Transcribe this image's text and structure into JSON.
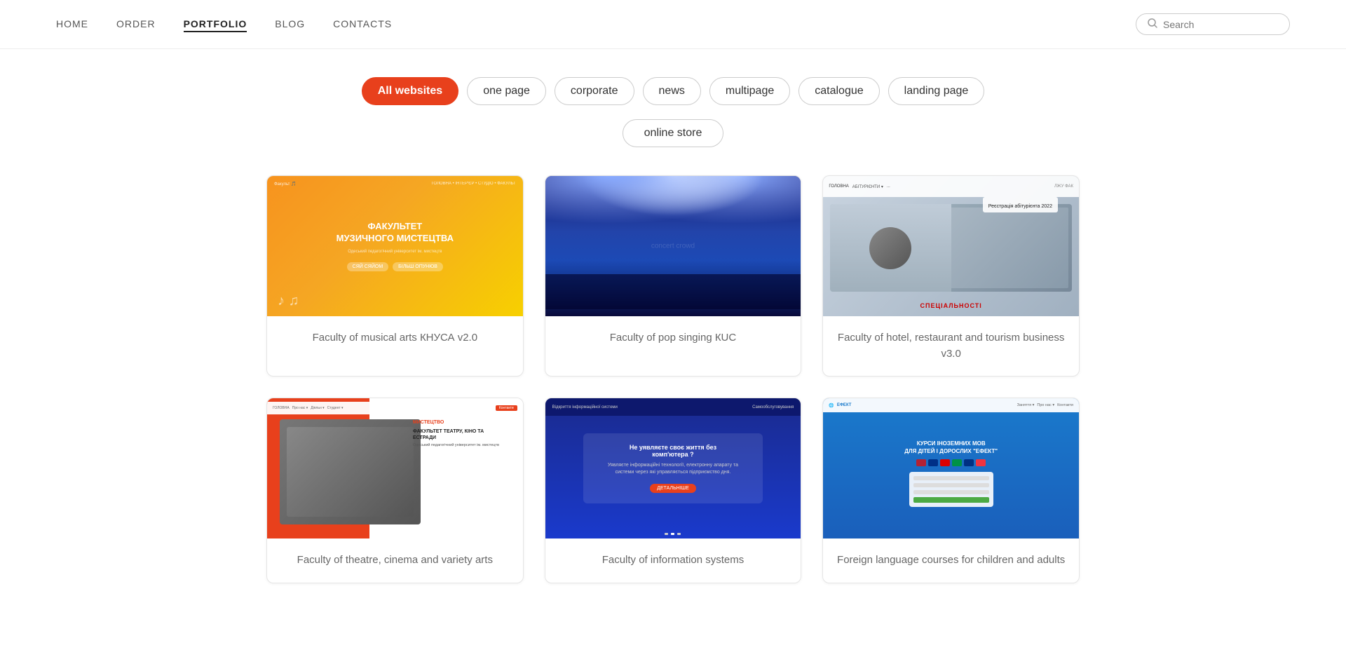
{
  "navbar": {
    "links": [
      {
        "id": "home",
        "label": "HOME",
        "active": false
      },
      {
        "id": "order",
        "label": "ORDER",
        "active": false
      },
      {
        "id": "portfolio",
        "label": "PORTFOLIO",
        "active": true
      },
      {
        "id": "blog",
        "label": "BLOG",
        "active": false
      },
      {
        "id": "contacts",
        "label": "CONTACTS",
        "active": false
      }
    ],
    "search_placeholder": "Search"
  },
  "filters": {
    "row1": [
      {
        "id": "all-websites",
        "label": "All websites",
        "active": true
      },
      {
        "id": "one-page",
        "label": "one page",
        "active": false
      },
      {
        "id": "corporate",
        "label": "corporate",
        "active": false
      },
      {
        "id": "news",
        "label": "news",
        "active": false
      },
      {
        "id": "multipage",
        "label": "multipage",
        "active": false
      },
      {
        "id": "catalogue",
        "label": "catalogue",
        "active": false
      },
      {
        "id": "landing-page",
        "label": "landing page",
        "active": false
      }
    ],
    "row2": [
      {
        "id": "online-store",
        "label": "online store",
        "active": false
      }
    ]
  },
  "portfolio": {
    "cards": [
      {
        "id": "card-music-faculty",
        "label": "Faculty of musical arts КНУСА v2.0",
        "type": "music"
      },
      {
        "id": "card-pop-singing",
        "label": "Faculty of pop singing КUС",
        "type": "concert"
      },
      {
        "id": "card-hotel-faculty",
        "label": "Faculty of hotel, restaurant and tourism business v3.0",
        "type": "hotel"
      },
      {
        "id": "card-theatre",
        "label": "Faculty of theatre, cinema and variety arts",
        "type": "theatre"
      },
      {
        "id": "card-info-system",
        "label": "Faculty of information systems",
        "type": "info"
      },
      {
        "id": "card-language-school",
        "label": "Foreign language courses for children and adults",
        "type": "language"
      }
    ]
  }
}
